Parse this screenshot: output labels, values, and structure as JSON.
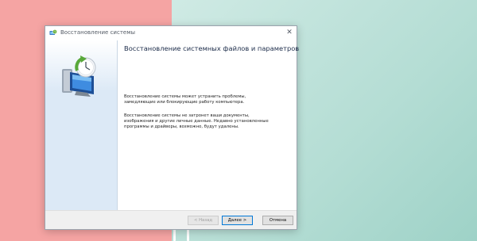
{
  "window": {
    "title": "Восстановление системы",
    "close_glyph": "✕"
  },
  "content": {
    "heading": "Восстановление системных файлов и параметров",
    "paragraph1": [
      "Восстановление системы может устранить проблемы,",
      "замедляющие или блокирующие работу компьютера."
    ],
    "paragraph2": [
      "Восстановление системы не затронет ваши документы,",
      "изображения и другие личные данные. Недавно установленные",
      "программы и драйверы, возможно, будут удалены."
    ]
  },
  "footer": {
    "back_label": "< Назад",
    "next_label": "Далее >",
    "cancel_label": "Отмена"
  },
  "icons": {
    "title_icon": "system-restore-icon",
    "hero_icon": "system-restore-clock-icon"
  },
  "colors": {
    "desktop_left": "#f5a4a3",
    "desktop_right": "#b4ddd4",
    "accent": "#0078d7",
    "heading": "#1a2a48"
  }
}
